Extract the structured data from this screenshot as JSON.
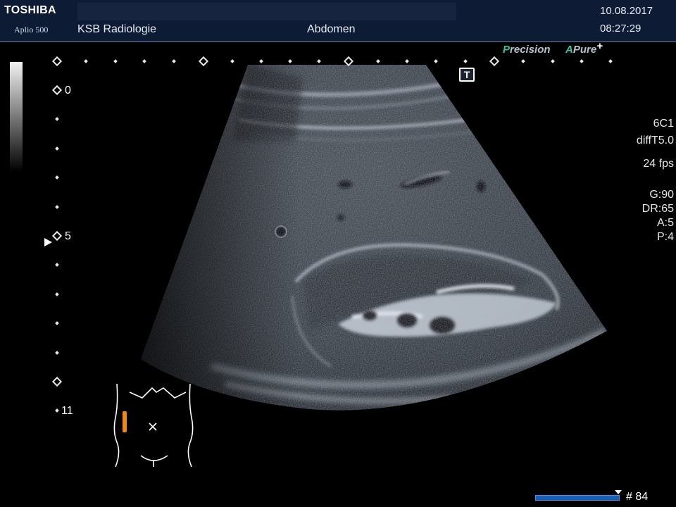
{
  "header": {
    "brand": "TOSHIBA",
    "model": "Aplio 500",
    "institution": "KSB Radiologie",
    "exam": "Abdomen",
    "date": "10.08.2017",
    "time": "08:27:29"
  },
  "logos": {
    "precision_prefix": "P",
    "precision_rest": "recision",
    "apure_prefix": "A",
    "apure_rest": "Pure",
    "apure_plus": "+"
  },
  "depth_scale": {
    "labels": [
      "0",
      "5",
      "11"
    ]
  },
  "parameters": {
    "probe": "6C1",
    "preset": "diffT5.0",
    "frame_rate": "24 fps",
    "gain": "G:90",
    "dynamic_range": "DR:65",
    "acoustic_power": "A:5",
    "persistence": "P:4"
  },
  "tools": {
    "text_annotation": "T"
  },
  "cine": {
    "frame": "# 84"
  },
  "colors": {
    "header_bg": "#0d1b35",
    "accent_teal": "#3cc0a0",
    "body_marker_probe": "#f08a10",
    "cine_bar": "#1a5fb4"
  }
}
